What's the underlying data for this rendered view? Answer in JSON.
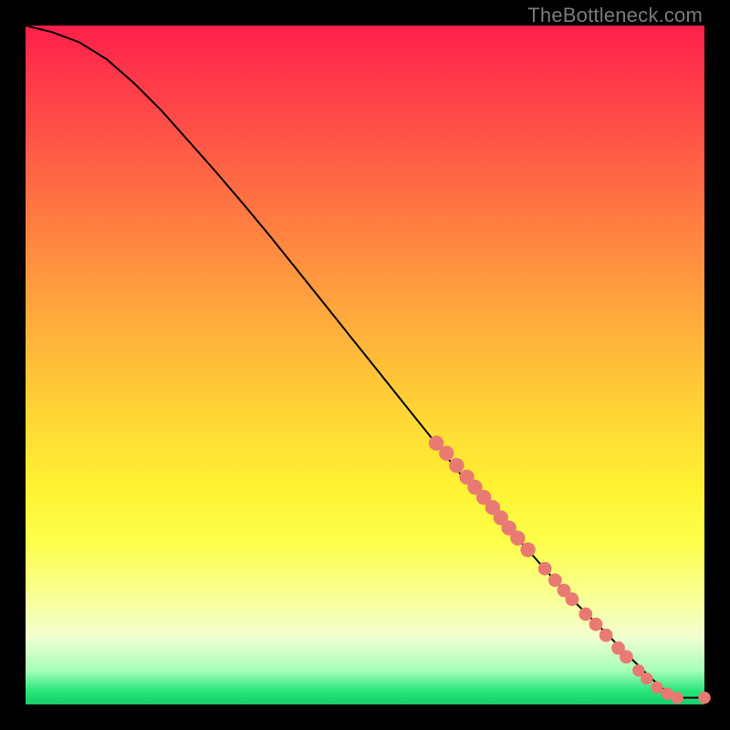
{
  "attribution": "TheBottleneck.com",
  "colors": {
    "marker": "#e87a72",
    "line": "#000000",
    "frame": "#000000"
  },
  "chart_data": {
    "type": "line",
    "title": "",
    "xlabel": "",
    "ylabel": "",
    "xlim": [
      0,
      100
    ],
    "ylim": [
      0,
      100
    ],
    "grid": false,
    "legend": false,
    "series": [
      {
        "name": "curve",
        "x": [
          0,
          4,
          8,
          12,
          16,
          20,
          24,
          28,
          32,
          36,
          40,
          44,
          48,
          52,
          56,
          60,
          64,
          68,
          72,
          76,
          80,
          84,
          88,
          92,
          94,
          96,
          100
        ],
        "y": [
          100,
          99,
          97.5,
          95,
          91.5,
          87.5,
          83,
          78.5,
          73.8,
          69,
          64,
          59,
          54,
          49,
          44,
          39,
          34,
          29.5,
          25,
          20.5,
          16,
          12,
          8,
          4,
          2.2,
          1.0,
          1.0
        ]
      }
    ],
    "markers": [
      {
        "x": 60.5,
        "y": 38.5,
        "r": 1.1
      },
      {
        "x": 62.0,
        "y": 37.0,
        "r": 1.1
      },
      {
        "x": 63.5,
        "y": 35.2,
        "r": 1.1
      },
      {
        "x": 65.0,
        "y": 33.5,
        "r": 1.1
      },
      {
        "x": 66.2,
        "y": 32.0,
        "r": 1.1
      },
      {
        "x": 67.5,
        "y": 30.5,
        "r": 1.1
      },
      {
        "x": 68.8,
        "y": 29.0,
        "r": 1.1
      },
      {
        "x": 70.0,
        "y": 27.5,
        "r": 1.1
      },
      {
        "x": 71.2,
        "y": 26.0,
        "r": 1.1
      },
      {
        "x": 72.5,
        "y": 24.5,
        "r": 1.1
      },
      {
        "x": 74.0,
        "y": 22.8,
        "r": 1.1
      },
      {
        "x": 76.5,
        "y": 20.0,
        "r": 1.0
      },
      {
        "x": 78.0,
        "y": 18.3,
        "r": 1.0
      },
      {
        "x": 79.3,
        "y": 16.8,
        "r": 1.0
      },
      {
        "x": 80.5,
        "y": 15.5,
        "r": 1.0
      },
      {
        "x": 82.5,
        "y": 13.3,
        "r": 1.0
      },
      {
        "x": 84.0,
        "y": 11.8,
        "r": 1.0
      },
      {
        "x": 85.5,
        "y": 10.2,
        "r": 1.0
      },
      {
        "x": 87.3,
        "y": 8.3,
        "r": 1.0
      },
      {
        "x": 88.5,
        "y": 7.0,
        "r": 1.0
      },
      {
        "x": 90.3,
        "y": 5.0,
        "r": 0.9
      },
      {
        "x": 91.5,
        "y": 3.8,
        "r": 0.9
      },
      {
        "x": 93.0,
        "y": 2.5,
        "r": 0.9
      },
      {
        "x": 94.5,
        "y": 1.6,
        "r": 0.9
      },
      {
        "x": 96.0,
        "y": 1.0,
        "r": 0.9
      },
      {
        "x": 100.0,
        "y": 1.0,
        "r": 0.9
      }
    ]
  }
}
